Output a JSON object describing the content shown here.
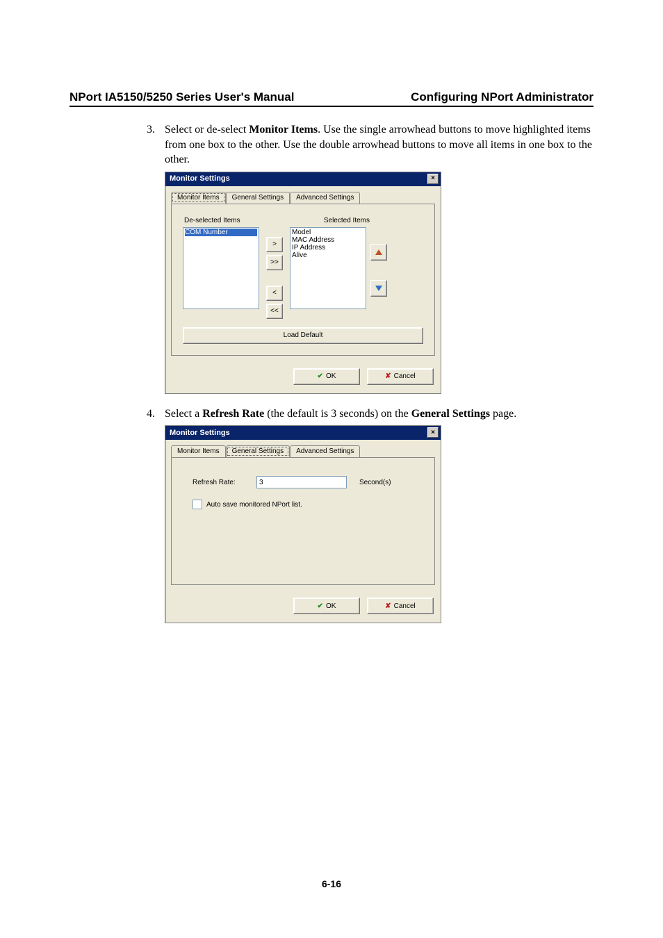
{
  "header": {
    "left": "NPort IA5150/5250 Series User's Manual",
    "right": "Configuring NPort Administrator"
  },
  "steps": {
    "s3": {
      "num": "3.",
      "t1": "Select or de-select ",
      "b1": "Monitor Items",
      "t2": ". Use the single arrowhead buttons to move highlighted items from one box to the other. Use the double arrowhead buttons to move all items in one box to the other."
    },
    "s4": {
      "num": "4.",
      "t1": "Select a ",
      "b1": "Refresh Rate",
      "t2": " (the default is 3 seconds) on the ",
      "b2": "General Settings",
      "t3": " page."
    }
  },
  "dlg": {
    "title": "Monitor Settings",
    "close": "×",
    "tabs": {
      "monitor": "Monitor Items",
      "general": "General Settings",
      "advanced": "Advanced Settings"
    },
    "labels": {
      "deselected": "De-selected Items",
      "selected": "Selected Items"
    },
    "deselected_items": [
      "COM Number"
    ],
    "selected_items": [
      "Model",
      "MAC Address",
      "IP Address",
      "Alive"
    ],
    "move": {
      "r": ">",
      "rr": ">>",
      "l": "<",
      "ll": "<<"
    },
    "load_default": "Load Default",
    "ok": "OK",
    "cancel": "Cancel"
  },
  "dlg2": {
    "refresh_label": "Refresh Rate:",
    "refresh_value": "3",
    "seconds": "Second(s)",
    "autosave": "Auto save monitored NPort list."
  },
  "footer": {
    "pagenum": "6-16"
  }
}
